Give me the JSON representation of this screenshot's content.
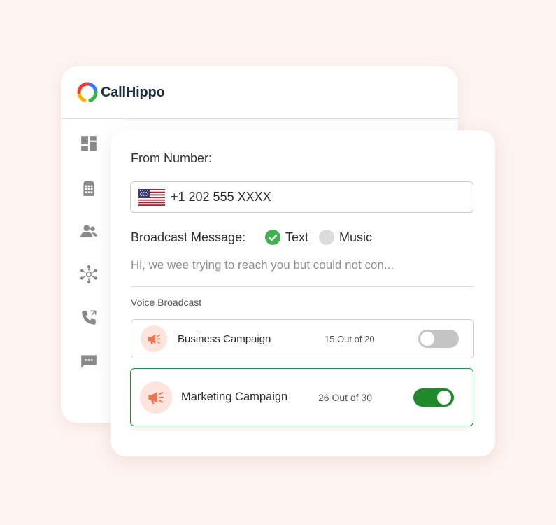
{
  "app": {
    "brand": "CallHippo"
  },
  "sidebar": {
    "items": [
      {
        "icon": "dashboard-icon"
      },
      {
        "icon": "dialpad-icon"
      },
      {
        "icon": "users-icon"
      },
      {
        "icon": "integrations-icon"
      },
      {
        "icon": "call-logs-icon"
      },
      {
        "icon": "sms-icon"
      }
    ]
  },
  "form": {
    "from_label": "From Number:",
    "phone": {
      "country_flag": "us-flag-icon",
      "value": "+1 202 555 XXXX"
    },
    "broadcast": {
      "label": "Broadcast Message:",
      "options": [
        {
          "label": "Text",
          "selected": true
        },
        {
          "label": "Music",
          "selected": false
        }
      ]
    },
    "message": {
      "value": "Hi, we wee trying to reach you but could not con..."
    },
    "voice_broadcast_label": "Voice Broadcast",
    "campaigns": [
      {
        "name": "Business Campaign",
        "count": "15 Out of 20",
        "enabled": false
      },
      {
        "name": "Marketing Campaign",
        "count": "26 Out of 30",
        "enabled": true
      }
    ]
  },
  "colors": {
    "background": "#fdf3ef",
    "accent_green": "#208a2b",
    "check_green": "#3fb14f",
    "megaphone": "#e8754f",
    "megaphone_bg": "#fde4dc"
  }
}
